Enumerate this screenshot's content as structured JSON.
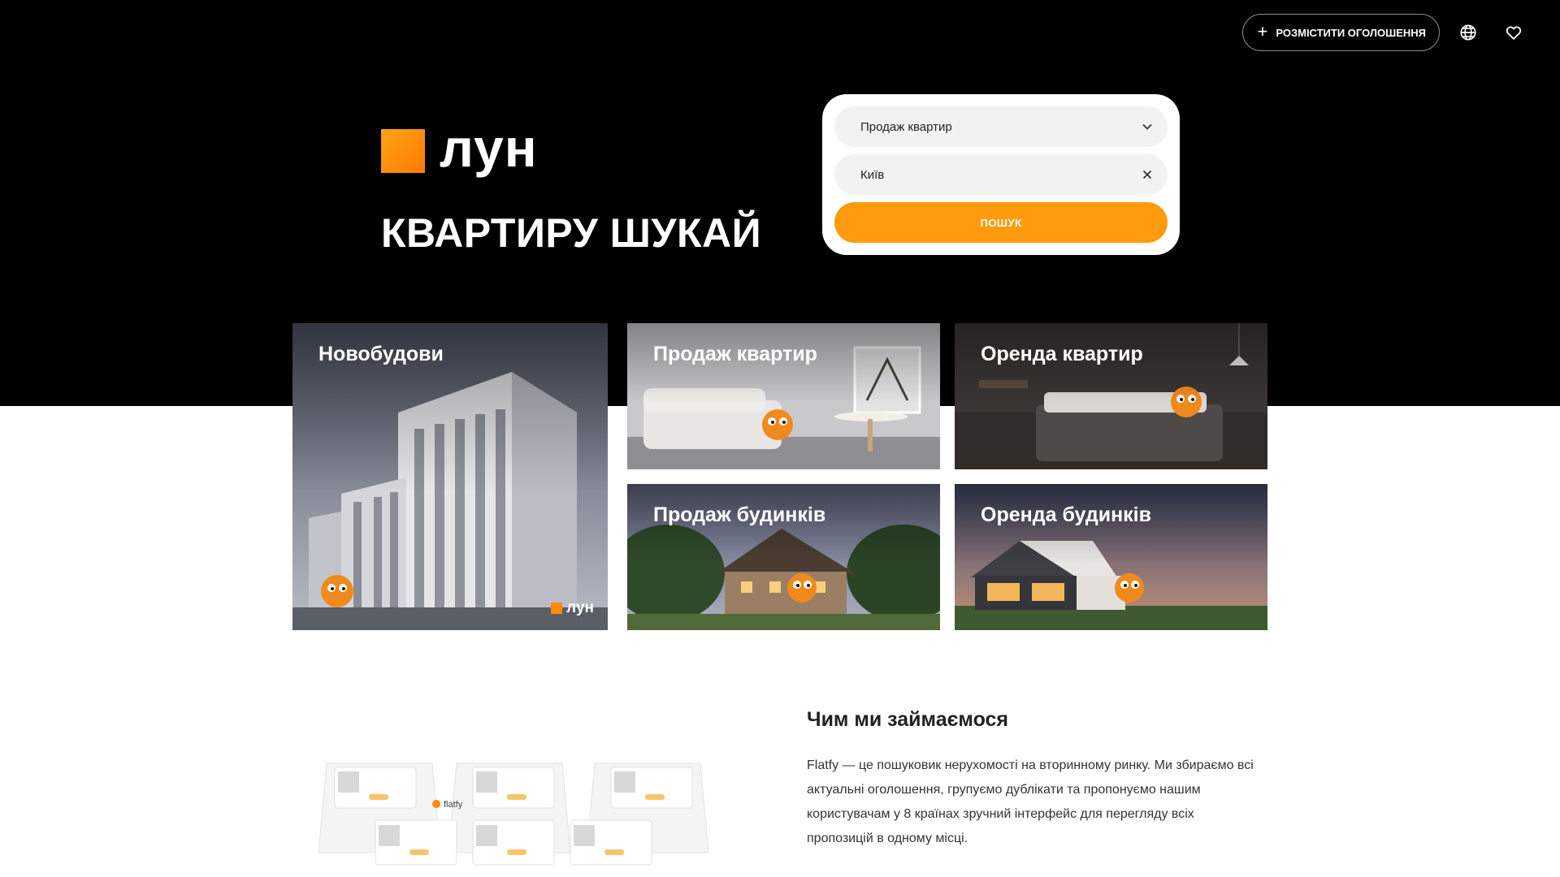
{
  "nav": {
    "post_ad_label": "РОЗМІСТИТИ ОГОЛОШЕННЯ",
    "plus_icon": "plus-icon",
    "language_icon": "globe-icon",
    "favorites_icon": "heart-icon"
  },
  "brand": {
    "logo_text": "лун",
    "slogan": "КВАРТИРУ ШУКАЙ",
    "accent_color": "#ff9b0d"
  },
  "search": {
    "deal_type": "Продаж квартир",
    "city": "Київ",
    "submit_label": "ПОШУК"
  },
  "categories": [
    {
      "title": "Новобудови"
    },
    {
      "title": "Продаж квартир"
    },
    {
      "title": "Оренда квартир"
    },
    {
      "title": "Продаж будинків"
    },
    {
      "title": "Оренда будинків"
    }
  ],
  "watermark": {
    "logo_text": "лун"
  },
  "illustration": {
    "brand_label": "flatfy"
  },
  "about": {
    "title": "Чим ми займаємося",
    "text": "Flatfy — це пошуковик нерухомості на вторинному ринку. Ми збираємо всі актуальні оголошення, групуємо дублікати та пропонуємо нашим користувачам у 8 країнах зручний інтерфейс для перегляду всіх пропозицій в одному місці."
  }
}
